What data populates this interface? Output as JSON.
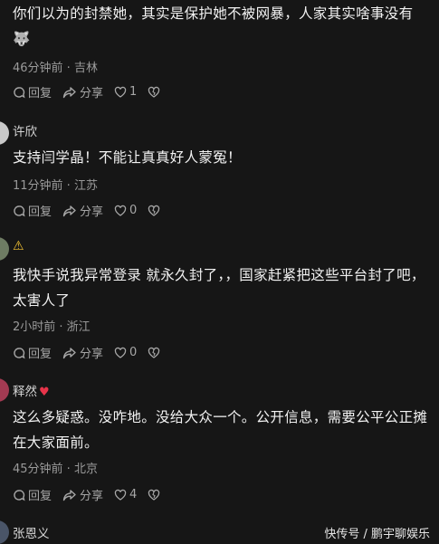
{
  "comments": [
    {
      "text": "你们以为的封禁她，其实是保护她不被网暴，人家其实啥事没有 🐺",
      "meta": "46分钟前 · 吉林",
      "reply": "回复",
      "share": "分享",
      "likes": "1"
    },
    {
      "user": "许欣",
      "text": "支持闫学晶！不能让真真好人蒙冤！",
      "meta": "11分钟前 · 江苏",
      "reply": "回复",
      "share": "分享",
      "likes": "0"
    },
    {
      "user": "⚠",
      "text": "我快手说我异常登录 就永久封了，，国家赶紧把这些平台封了吧，太害人了",
      "meta": "2小时前 · 浙江",
      "reply": "回复",
      "share": "分享",
      "likes": "0"
    },
    {
      "user": "释然",
      "user_badge": "♥",
      "text": "这么多疑惑。没咋地。没给大众一个。公开信息，需要公平公正摊在大家面前。",
      "meta": "45分钟前 · 北京",
      "reply": "回复",
      "share": "分享",
      "likes": "4"
    },
    {
      "user": "张恩义"
    }
  ],
  "watermark": "快传号 / 鹏宇聊娱乐",
  "colors": {
    "background": "#161616",
    "text": "#f2f2f2",
    "meta": "#9a9a9a",
    "heart": "#e8344a",
    "warning": "#f3c234"
  }
}
